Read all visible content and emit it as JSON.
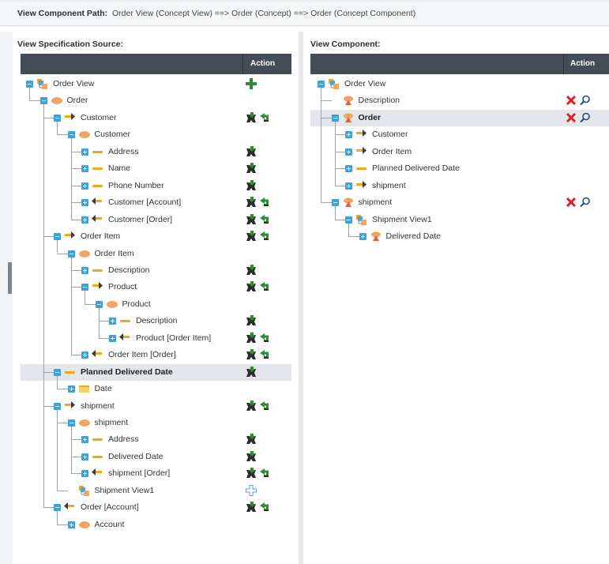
{
  "header": {
    "path_label": "View Component Path:",
    "path_value": "Order View (Concept View) ==> Order (Concept) ==> Order (Concept Component)"
  },
  "left": {
    "title": "View Specification Source:",
    "action_header": "Action",
    "rows": [
      {
        "label": "Order View",
        "depth": 0,
        "icon": "concept-view",
        "toggle": "minus",
        "actions": [
          "add"
        ]
      },
      {
        "label": "Order",
        "depth": 1,
        "icon": "concept",
        "toggle": "minus",
        "actions": []
      },
      {
        "label": "Customer",
        "depth": 2,
        "icon": "arrow-right",
        "toggle": "minus",
        "actions": [
          "include",
          "link"
        ]
      },
      {
        "label": "Customer",
        "depth": 3,
        "icon": "concept",
        "toggle": "minus",
        "actions": []
      },
      {
        "label": "Address",
        "depth": 4,
        "icon": "attribute",
        "toggle": "plus",
        "actions": [
          "include"
        ]
      },
      {
        "label": "Name",
        "depth": 4,
        "icon": "attribute",
        "toggle": "plus",
        "actions": [
          "include"
        ]
      },
      {
        "label": "Phone Number",
        "depth": 4,
        "icon": "attribute",
        "toggle": "plus",
        "actions": [
          "include"
        ]
      },
      {
        "label": "Customer [Account]",
        "depth": 4,
        "icon": "arrow-left",
        "toggle": "plus",
        "actions": [
          "include",
          "link"
        ]
      },
      {
        "label": "Customer [Order]",
        "depth": 4,
        "icon": "arrow-left",
        "toggle": "plus",
        "actions": [
          "include",
          "link"
        ]
      },
      {
        "label": "Order Item",
        "depth": 2,
        "icon": "arrow-right",
        "toggle": "minus",
        "actions": [
          "include",
          "link"
        ]
      },
      {
        "label": "Order Item",
        "depth": 3,
        "icon": "concept",
        "toggle": "minus",
        "actions": []
      },
      {
        "label": "Description",
        "depth": 4,
        "icon": "attribute",
        "toggle": "plus",
        "actions": [
          "include"
        ]
      },
      {
        "label": "Product",
        "depth": 4,
        "icon": "arrow-right",
        "toggle": "minus",
        "actions": [
          "include",
          "link"
        ]
      },
      {
        "label": "Product",
        "depth": 5,
        "icon": "concept",
        "toggle": "minus",
        "actions": []
      },
      {
        "label": "Description",
        "depth": 6,
        "icon": "attribute",
        "toggle": "plus",
        "actions": [
          "include"
        ]
      },
      {
        "label": "Product [Order Item]",
        "depth": 6,
        "icon": "arrow-left",
        "toggle": "plus",
        "actions": [
          "include",
          "link"
        ]
      },
      {
        "label": "Order Item [Order]",
        "depth": 4,
        "icon": "arrow-left",
        "toggle": "plus",
        "actions": [
          "include",
          "link"
        ]
      },
      {
        "label": "Planned Delivered Date",
        "depth": 2,
        "icon": "attribute",
        "toggle": "minus",
        "actions": [
          "include"
        ],
        "selected": true
      },
      {
        "label": "Date",
        "depth": 3,
        "icon": "datatype",
        "toggle": "plus",
        "actions": []
      },
      {
        "label": "shipment",
        "depth": 2,
        "icon": "arrow-right",
        "toggle": "minus",
        "actions": [
          "include",
          "link"
        ]
      },
      {
        "label": "shipment",
        "depth": 3,
        "icon": "concept",
        "toggle": "minus",
        "actions": []
      },
      {
        "label": "Address",
        "depth": 4,
        "icon": "attribute",
        "toggle": "plus",
        "actions": [
          "include"
        ]
      },
      {
        "label": "Delivered Date",
        "depth": 4,
        "icon": "attribute",
        "toggle": "plus",
        "actions": [
          "include"
        ]
      },
      {
        "label": "shipment [Order]",
        "depth": 4,
        "icon": "arrow-left",
        "toggle": "plus",
        "actions": [
          "include",
          "link"
        ]
      },
      {
        "label": "Shipment View1",
        "depth": 3,
        "icon": "concept-view",
        "toggle": "none",
        "actions": [
          "add-outline"
        ]
      },
      {
        "label": "Order [Account]",
        "depth": 2,
        "icon": "arrow-left",
        "toggle": "minus",
        "actions": [
          "include",
          "link"
        ]
      },
      {
        "label": "Account",
        "depth": 3,
        "icon": "concept",
        "toggle": "plus",
        "actions": []
      }
    ]
  },
  "right": {
    "title": "View Component:",
    "action_header": "Action",
    "rows": [
      {
        "label": "Order View",
        "depth": 0,
        "icon": "concept-view",
        "toggle": "minus",
        "actions": []
      },
      {
        "label": "Description",
        "depth": 1,
        "icon": "component",
        "toggle": "none",
        "actions": [
          "remove",
          "search"
        ]
      },
      {
        "label": "Order",
        "depth": 1,
        "icon": "component",
        "toggle": "minus",
        "actions": [
          "remove",
          "search"
        ],
        "selected": true
      },
      {
        "label": "Customer",
        "depth": 2,
        "icon": "arrow-right",
        "toggle": "plus",
        "actions": []
      },
      {
        "label": "Order Item",
        "depth": 2,
        "icon": "arrow-right",
        "toggle": "plus",
        "actions": []
      },
      {
        "label": "Planned Delivered Date",
        "depth": 2,
        "icon": "attribute",
        "toggle": "plus",
        "actions": []
      },
      {
        "label": "shipment",
        "depth": 2,
        "icon": "arrow-right",
        "toggle": "plus",
        "actions": []
      },
      {
        "label": "shipment",
        "depth": 1,
        "icon": "component",
        "toggle": "minus",
        "actions": [
          "remove",
          "search"
        ]
      },
      {
        "label": "Shipment View1",
        "depth": 2,
        "icon": "concept-view",
        "toggle": "minus",
        "actions": []
      },
      {
        "label": "Delivered Date",
        "depth": 3,
        "icon": "component",
        "toggle": "plus",
        "actions": []
      }
    ]
  },
  "colors": {
    "header_bg": "#444c55",
    "toggle": "#3aa3dd",
    "concept": "#f2a468",
    "attribute": "#f0a818",
    "include": "#2f8a3a",
    "remove": "#e02020",
    "selected_row": "#e3e7ec"
  }
}
